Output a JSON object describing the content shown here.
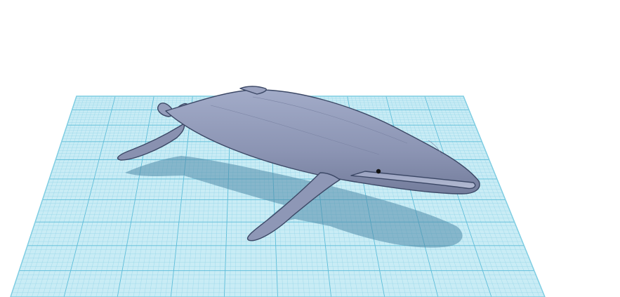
{
  "scene": {
    "model_name": "humpback-whale",
    "workplane_color": "#c9ecf5",
    "grid_minor_color": "#8fd3e6",
    "grid_major_color": "#5cbcd8",
    "model_color": "#8e97b6",
    "model_outline_color": "#3c4866",
    "shadow_color": "#4f8aa8",
    "background_color": "#ffffff"
  }
}
